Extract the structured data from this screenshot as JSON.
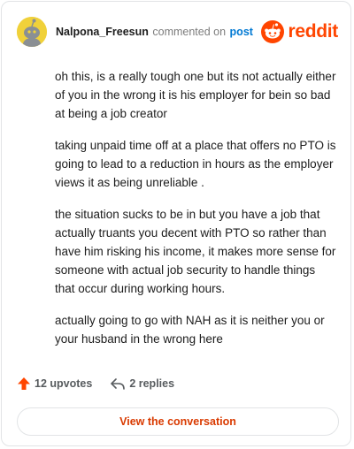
{
  "header": {
    "username": "Nalpona_Freesun",
    "verb": "commented on",
    "post_link": "post",
    "brand": "reddit"
  },
  "comment": {
    "paragraphs": [
      "oh this, is a really tough one but its not actually either of you in the wrong it is his employer for bein so bad at being a job creator",
      "taking unpaid time off at a place that offers no PTO is going to lead to a reduction in hours as the employer views it as being unreliable .",
      "the situation sucks to be in but you have a job that actually truants you decent with PTO so rather than have him risking his income, it makes more sense for someone with actual job security to handle things that occur during working hours.",
      "actually going to go with NAH as it is neither you or your husband in the wrong here"
    ]
  },
  "footer": {
    "upvotes": "12 upvotes",
    "replies": "2 replies"
  },
  "cta": {
    "label": "View the conversation"
  },
  "colors": {
    "brand": "#ff4500",
    "link": "#0079d3",
    "cta_text": "#d93a00",
    "avatar_bg": "#f0d13a"
  },
  "icons": {
    "avatar": "snoo-avatar-icon",
    "logo": "reddit-logo-icon",
    "upvote": "upvote-arrow-icon",
    "reply": "reply-arrow-icon"
  }
}
